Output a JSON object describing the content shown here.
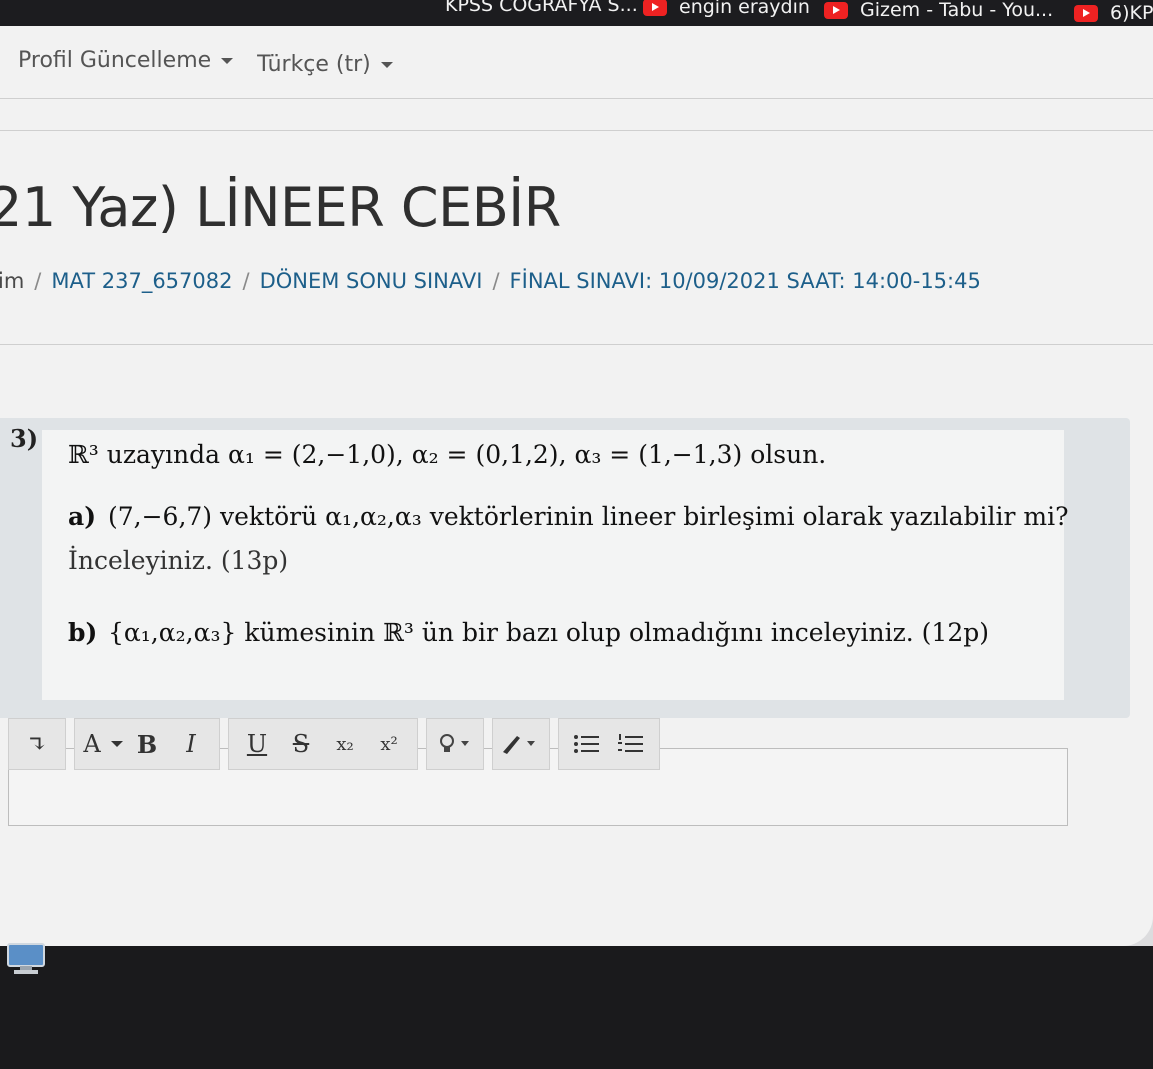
{
  "bookmarks": [
    {
      "label": "KPSS COĞRAFYA S...",
      "icon": "youtube-icon"
    },
    {
      "label": "engin eraydın",
      "icon": "youtube-icon"
    },
    {
      "label": "Gizem - Tabu - You...",
      "icon": "youtube-icon"
    },
    {
      "label": "6)KP",
      "icon": "youtube-icon"
    }
  ],
  "user_nav": {
    "profile_label": "Profil Güncelleme",
    "language_label": "Türkçe (tr)"
  },
  "course": {
    "title": "21 Yaz) LİNEER CEBİR"
  },
  "breadcrumb": {
    "items": [
      "im",
      "MAT 237_657082",
      "DÖNEM SONU SINAVI",
      "FİNAL SINAVI: 10/09/2021 SAAT: 14:00-15:45"
    ]
  },
  "question": {
    "number": "3)",
    "intro": "ℝ³ uzayında α₁ = (2,−1,0), α₂ = (0,1,2), α₃ = (1,−1,3)   olsun.",
    "part_a_label": "a)",
    "part_a_line1": "(7,−6,7)  vektörü   α₁,α₂,α₃   vektörlerinin lineer birleşimi olarak yazılabilir mi?",
    "part_a_line2": "İnceleyiniz. (13p)",
    "part_b_label": "b)",
    "part_b_text": "{α₁,α₂,α₃}  kümesinin  ℝ³  ün bir bazı olup olmadığını inceleyiniz. (12p)"
  },
  "toolbar": {
    "collapse": "↴",
    "font": "A",
    "bold": "B",
    "italic": "I",
    "underline": "U",
    "strike": "S",
    "subscript": "x₂",
    "superscript": "x²",
    "colors": {
      "youtube_red": "#e22222",
      "link_blue": "#1d5f8a"
    }
  }
}
